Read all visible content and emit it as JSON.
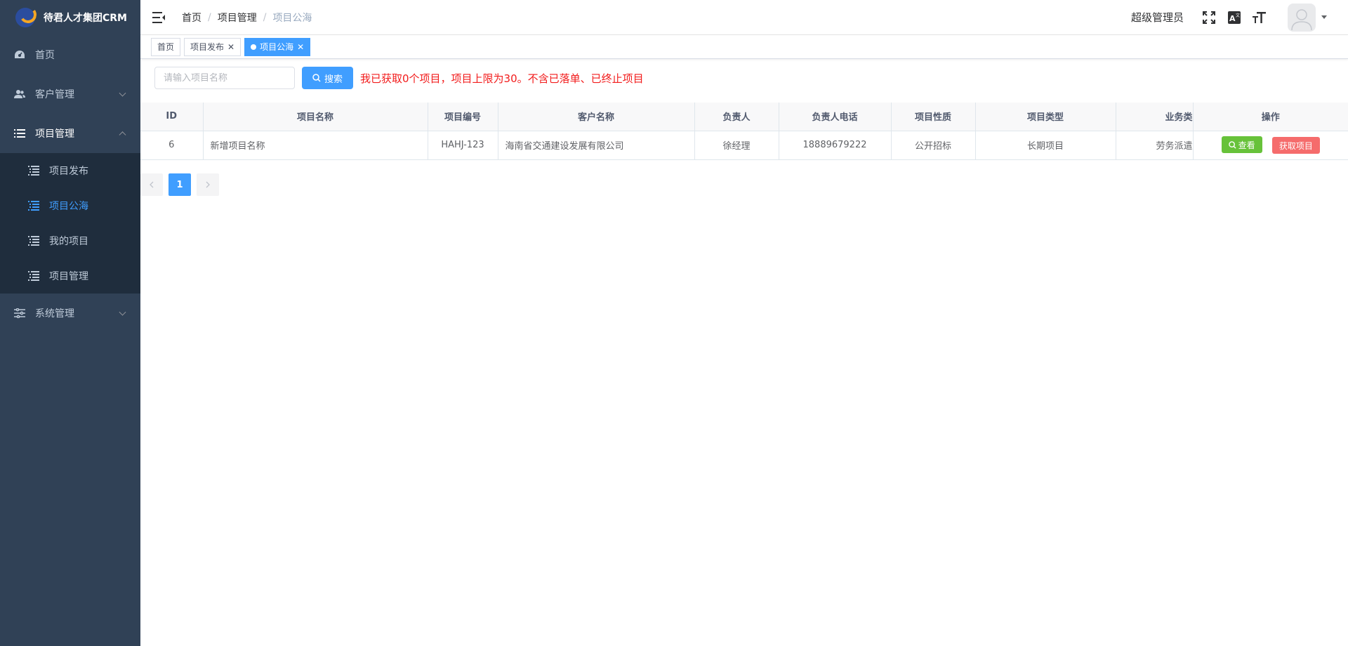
{
  "app": {
    "title": "待君人才集团CRM"
  },
  "sidebar": {
    "items": [
      {
        "label": "首页"
      },
      {
        "label": "客户管理"
      },
      {
        "label": "项目管理"
      },
      {
        "label": "系统管理"
      }
    ],
    "project_sub": [
      {
        "label": "项目发布"
      },
      {
        "label": "项目公海"
      },
      {
        "label": "我的项目"
      },
      {
        "label": "项目管理"
      }
    ]
  },
  "navbar": {
    "breadcrumb": [
      "首页",
      "项目管理",
      "项目公海"
    ],
    "user_name": "超级管理员"
  },
  "tags": [
    {
      "label": "首页"
    },
    {
      "label": "项目发布"
    },
    {
      "label": "项目公海"
    }
  ],
  "toolbar": {
    "search_placeholder": "请输入项目名称",
    "search_button": "搜索",
    "notice": "我已获取0个项目，项目上限为30。不含已落单、已终止项目"
  },
  "table": {
    "headers": [
      "ID",
      "项目名称",
      "项目编号",
      "客户名称",
      "负责人",
      "负责人电话",
      "项目性质",
      "项目类型",
      "业务类",
      "操作"
    ],
    "rows": [
      {
        "id": "6",
        "name": "新增项目名称",
        "code": "HAHJ-123",
        "customer": "海南省交通建设发展有限公司",
        "owner": "徐经理",
        "phone": "18889679222",
        "nature": "公开招标",
        "type": "长期项目",
        "business": "劳务派遣",
        "view_label": "查看",
        "get_label": "获取项目"
      }
    ]
  },
  "pagination": {
    "current": "1"
  },
  "colors": {
    "primary": "#409eff",
    "sidebar_bg": "#304156",
    "sidebar_sub_bg": "#1f2d3d",
    "danger": "#f56c6c",
    "success": "#67c23a",
    "notice": "#f21b1b"
  }
}
